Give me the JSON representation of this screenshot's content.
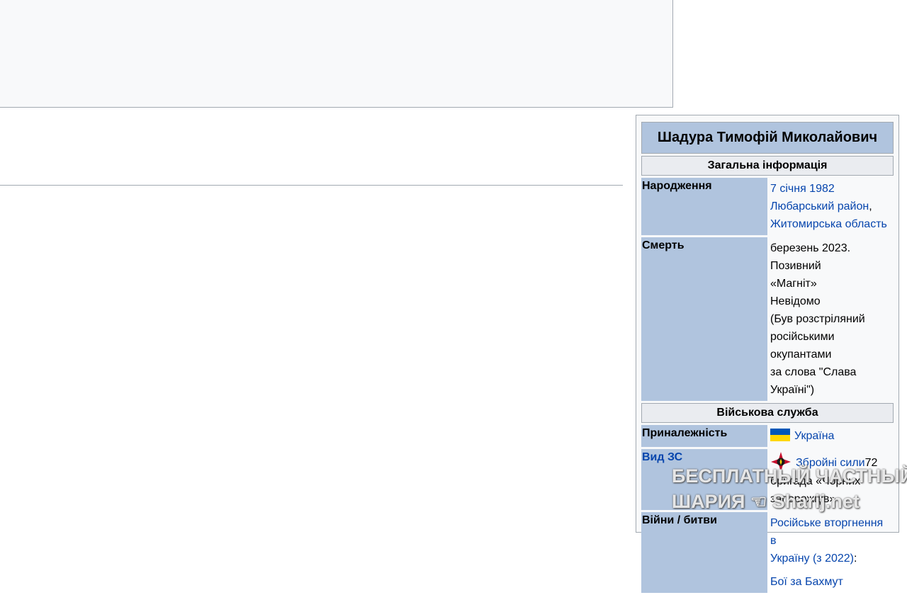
{
  "infobox": {
    "title": "Шадура Тимофій Миколайович",
    "section_general": "Загальна інформація",
    "birth": {
      "label": "Народження",
      "date": "7 січня 1982",
      "district": "Любарський район",
      "comma": ",",
      "region": "Житомирська область"
    },
    "death": {
      "label": "Смерть",
      "line1": "березень 2023. Позивний",
      "line2": "«Магніт»",
      "line3": "Невідомо",
      "line4": "(Був розстріляний",
      "line5": "російськими окупантами",
      "line6": "за слова \"Слава Україні\")"
    },
    "section_military": "Військова служба",
    "allegiance": {
      "label": "Приналежність",
      "value": "Україна",
      "icon": "ukraine-flag-icon"
    },
    "branch": {
      "label": "Вид ЗС",
      "link": "Збройні сили",
      "rest1": "72",
      "rest2": "бригада «Чорних",
      "rest3": "запорожців»",
      "icon": "armed-forces-emblem-icon"
    },
    "wars": {
      "label": "Війни / битви",
      "war_line1": "Російське вторгнення в",
      "war_line2": "Україну (з 2022)",
      "colon": ":",
      "battle": "Бої за Бахмут"
    }
  },
  "watermark": {
    "line1": "БЕСПЛАТНЫЙ ЧАСТНЫЙ",
    "line2_a": "ШАРИЯ",
    "line2_b": "Sharij.net"
  },
  "colors": {
    "link": "#0645ad",
    "header_bg": "#b0c4de",
    "section_bg": "#eaecf0",
    "border": "#a2a9b1"
  }
}
